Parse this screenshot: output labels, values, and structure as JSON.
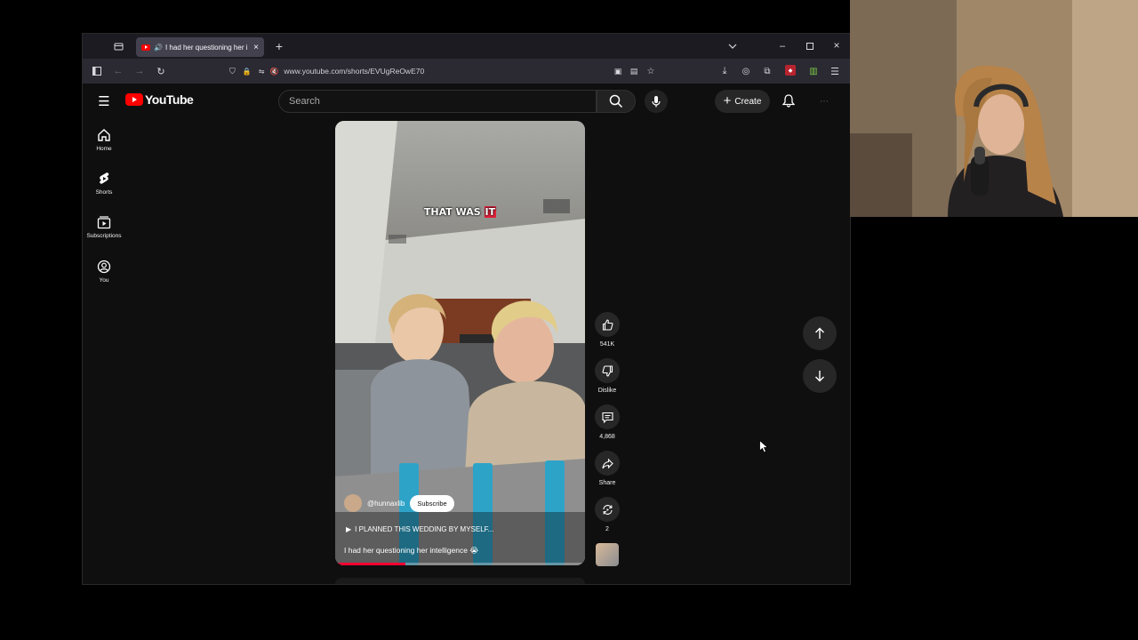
{
  "browser": {
    "tab_title": "I had her questioning her i",
    "url": "www.youtube.com/shorts/EVUgReOwE70"
  },
  "youtube": {
    "logo_text": "YouTube",
    "search_placeholder": "Search",
    "create_label": "Create",
    "sidebar": [
      {
        "label": "Home",
        "icon": "home-icon"
      },
      {
        "label": "Shorts",
        "icon": "shorts-icon"
      },
      {
        "label": "Subscriptions",
        "icon": "subscriptions-icon"
      },
      {
        "label": "You",
        "icon": "you-icon"
      }
    ]
  },
  "short": {
    "caption_main": "THAT WAS ",
    "caption_highlight": "IT",
    "channel": "@hunnaxlib",
    "subscribe_label": "Subscribe",
    "playlist": "I PLANNED THIS WEDDING BY MYSELF...",
    "title": "I had her questioning her intelligence 😭",
    "actions": {
      "likes": "541K",
      "dislike": "Dislike",
      "comments": "4,868",
      "share": "Share",
      "remix": "2"
    }
  },
  "colors": {
    "accent": "#ff0000",
    "bg": "#0f0f0f"
  }
}
